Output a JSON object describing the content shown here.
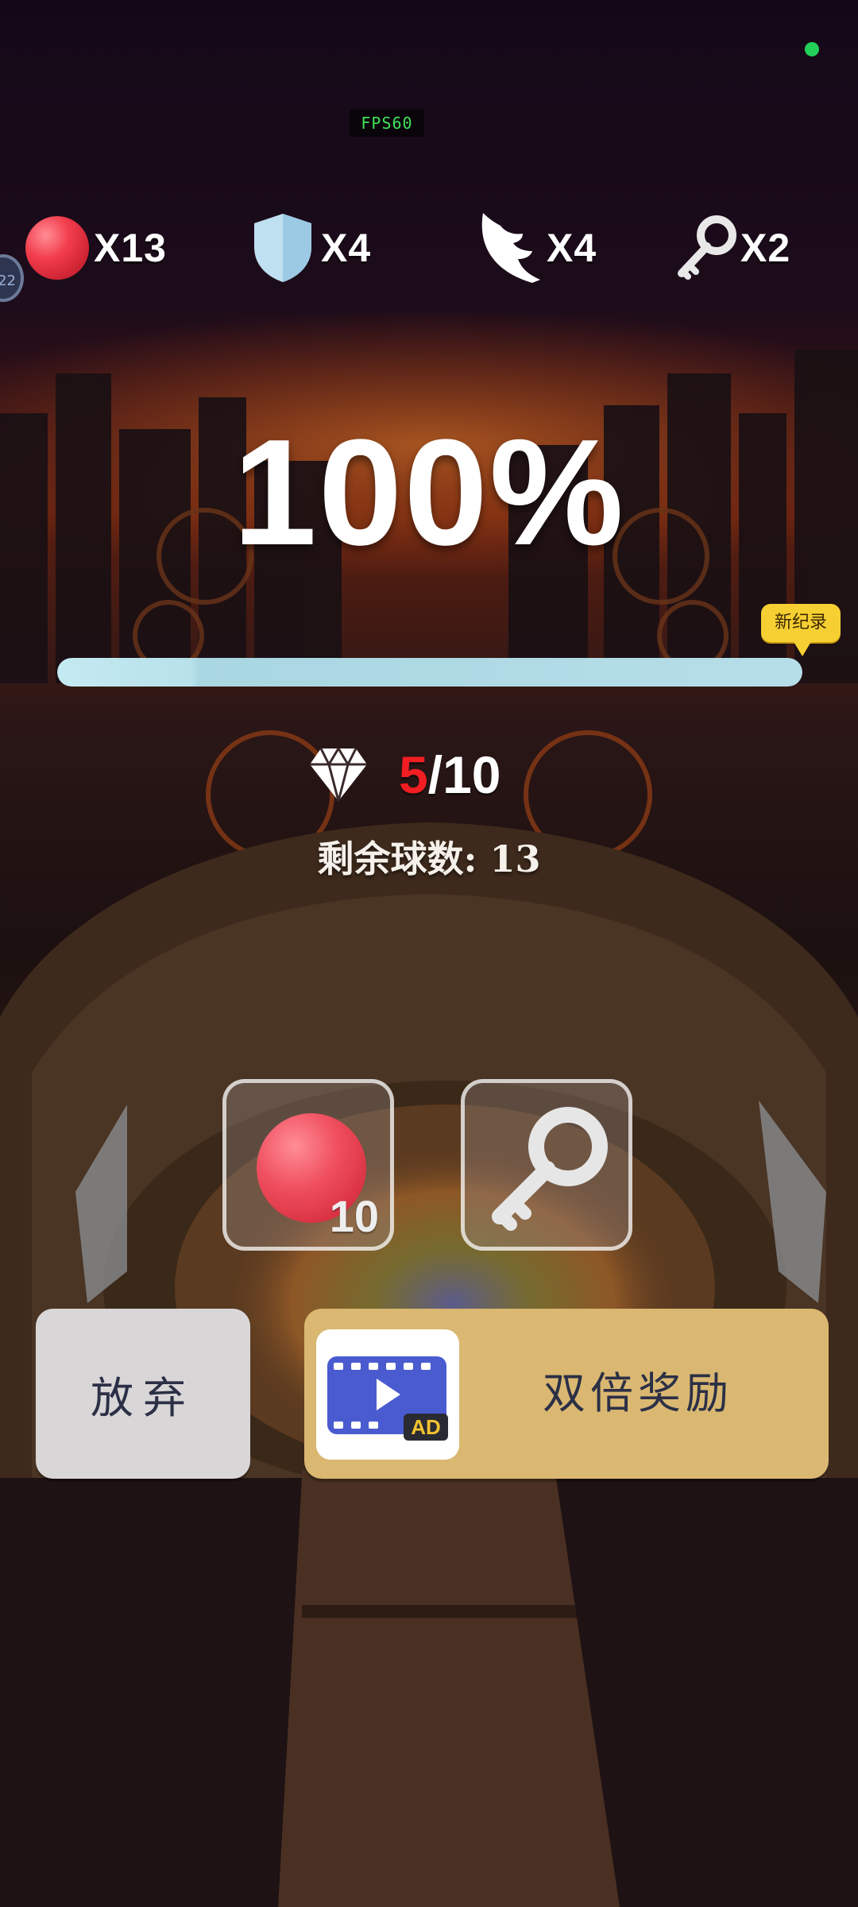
{
  "status": {
    "fps_label": "FPS60",
    "side_badge": "22"
  },
  "inventory": [
    {
      "item": "ball",
      "icon": "red-ball-icon",
      "count_label": "X13"
    },
    {
      "item": "shield",
      "icon": "shield-icon",
      "count_label": "X4"
    },
    {
      "item": "wing",
      "icon": "wing-icon",
      "count_label": "X4"
    },
    {
      "item": "key",
      "icon": "key-icon",
      "count_label": "X2"
    }
  ],
  "result": {
    "percent_label": "100%",
    "progress": 1.0,
    "record_badge": "新纪录"
  },
  "gems": {
    "icon": "diamond-icon",
    "collected": "5",
    "separator": "/",
    "total": "10",
    "remaining_label": "剩余球数: 13"
  },
  "rewards": [
    {
      "icon": "red-ball-icon",
      "amount": "10"
    },
    {
      "icon": "key-icon",
      "amount": ""
    }
  ],
  "buttons": {
    "give_up": "放弃",
    "double_reward": "双倍奖励",
    "ad_icon_text": "AD"
  },
  "colors": {
    "gem_collected": "#f01e22",
    "give_up_bg": "#d9d6d8",
    "double_bg": "#dab872",
    "progress_fill": "#b8e1ea"
  }
}
